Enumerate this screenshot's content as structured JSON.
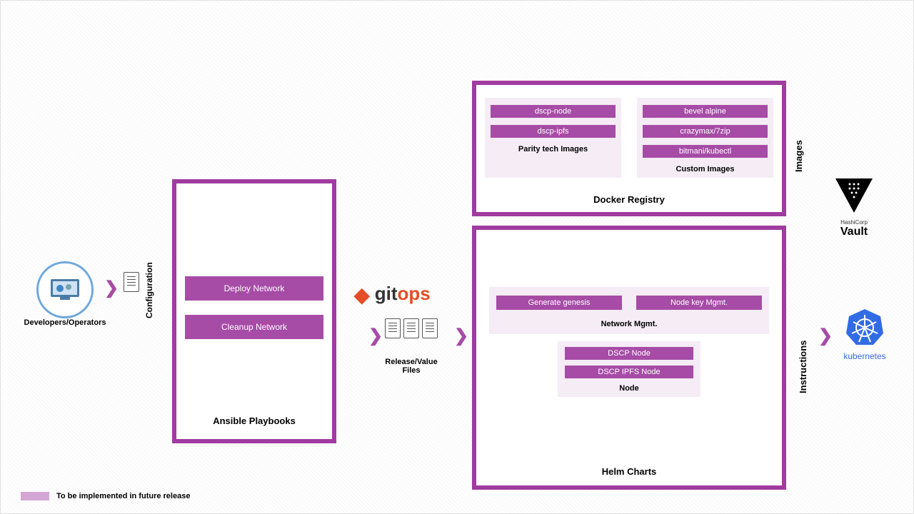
{
  "actors": {
    "dev_ops": "Developers/Operators"
  },
  "labels": {
    "configuration": "Configuration",
    "release_files": "Release/Value Files",
    "images": "Images",
    "instructions": "Instructions"
  },
  "ansible": {
    "title": "Ansible Playbooks",
    "deploy": "Deploy Network",
    "cleanup": "Cleanup Network"
  },
  "gitops": {
    "git": "git",
    "ops": "ops"
  },
  "registry": {
    "title": "Docker Registry",
    "parity": {
      "label": "Parity tech Images",
      "images": [
        "dscp-node",
        "dscp-ipfs"
      ]
    },
    "custom": {
      "label": "Custom Images",
      "images": [
        "bevel alpine",
        "crazymax/7zip",
        "bitmani/kubectl"
      ]
    }
  },
  "helm": {
    "title": "Helm Charts",
    "network": {
      "label": "Network Mgmt.",
      "items": [
        "Generate genesis",
        "Node key Mgmt."
      ]
    },
    "node": {
      "label": "Node",
      "items": [
        "DSCP Node",
        "DSCP IPFS Node"
      ]
    }
  },
  "vault": {
    "company": "HashiCorp",
    "name": "Vault"
  },
  "k8s": {
    "name": "kubernetes"
  },
  "legend": {
    "future": "To be implemented in future release"
  }
}
